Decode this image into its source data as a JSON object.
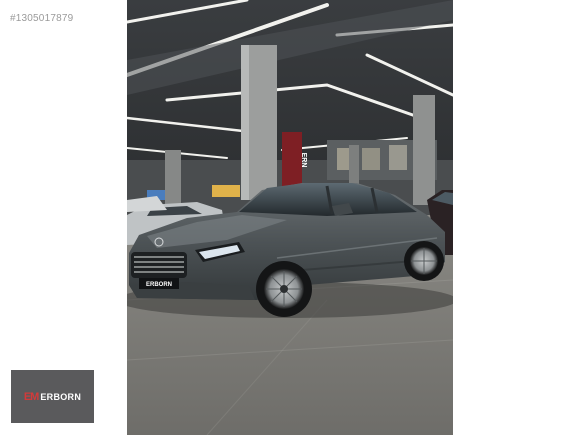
{
  "listing": {
    "id_label": "#1305017879"
  },
  "photo": {
    "subject": "dark grey sedan parked inside a showroom"
  },
  "watermark": {
    "brand": "ERBORN",
    "mark": "EM"
  },
  "plate": {
    "text": "ERBORN"
  },
  "banner": {
    "text": "ERN"
  },
  "colors": {
    "car_body": "#4d5356",
    "floor": "#7d7c78",
    "logo_bg": "#5a5a5c",
    "logo_accent": "#d23a3a"
  }
}
